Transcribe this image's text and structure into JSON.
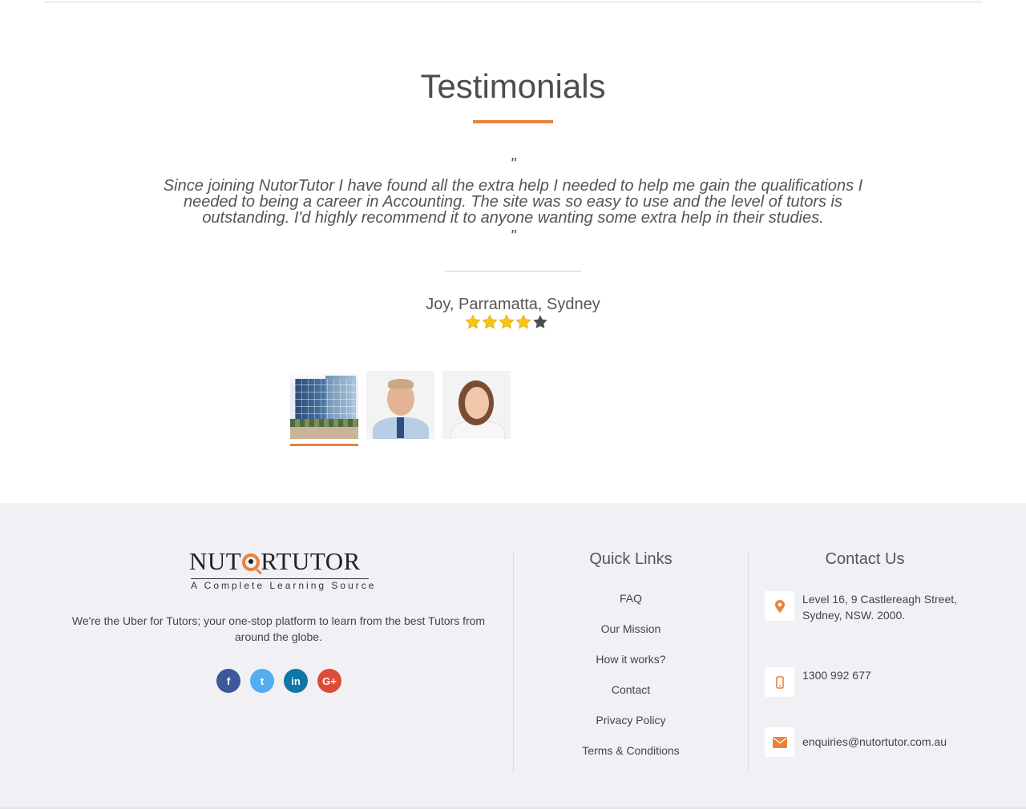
{
  "testimonials": {
    "title": "Testimonials",
    "quote_open": "\"",
    "quote": "Since joining NutorTutor I  have found all the extra  help I needed  to  help me gain the qualifications I needed to being  a career in Accounting. The site was  so easy to use and the level of tutors is outstanding. I'd highly recommend it to anyone wanting some extra help in their studies.",
    "quote_close": "\"",
    "author": "Joy, Parramatta, Sydney",
    "rating": 4,
    "rating_max": 5,
    "thumbnails": [
      {
        "name": "building-photo",
        "active": true
      },
      {
        "name": "man-photo",
        "active": false
      },
      {
        "name": "woman-photo",
        "active": false
      }
    ]
  },
  "footer": {
    "logo": {
      "text_before": "NUT",
      "text_after": "RTUTOR",
      "tagline": "A Complete Learning Source"
    },
    "about": "We're the Uber for Tutors; your one-stop platform to learn from the best Tutors from around the globe.",
    "social": [
      {
        "icon": "facebook-icon",
        "glyph": "f",
        "color": "#3b5998"
      },
      {
        "icon": "twitter-icon",
        "glyph": "t",
        "color": "#55acee"
      },
      {
        "icon": "linkedin-icon",
        "glyph": "in",
        "color": "#0e76a8"
      },
      {
        "icon": "google-plus-icon",
        "glyph": "G+",
        "color": "#dd4b39"
      }
    ],
    "quick_links": {
      "title": "Quick Links",
      "items": [
        "FAQ",
        "Our Mission",
        "How it works?",
        "Contact",
        "Privacy Policy",
        "Terms & Conditions"
      ]
    },
    "contact": {
      "title": "Contact Us",
      "address": "Level 16, 9 Castlereagh Street, Sydney, NSW. 2000.",
      "phone": "1300 992 677",
      "email": "enquiries@nutortutor.com.au"
    },
    "accent_color": "#e8833a"
  }
}
